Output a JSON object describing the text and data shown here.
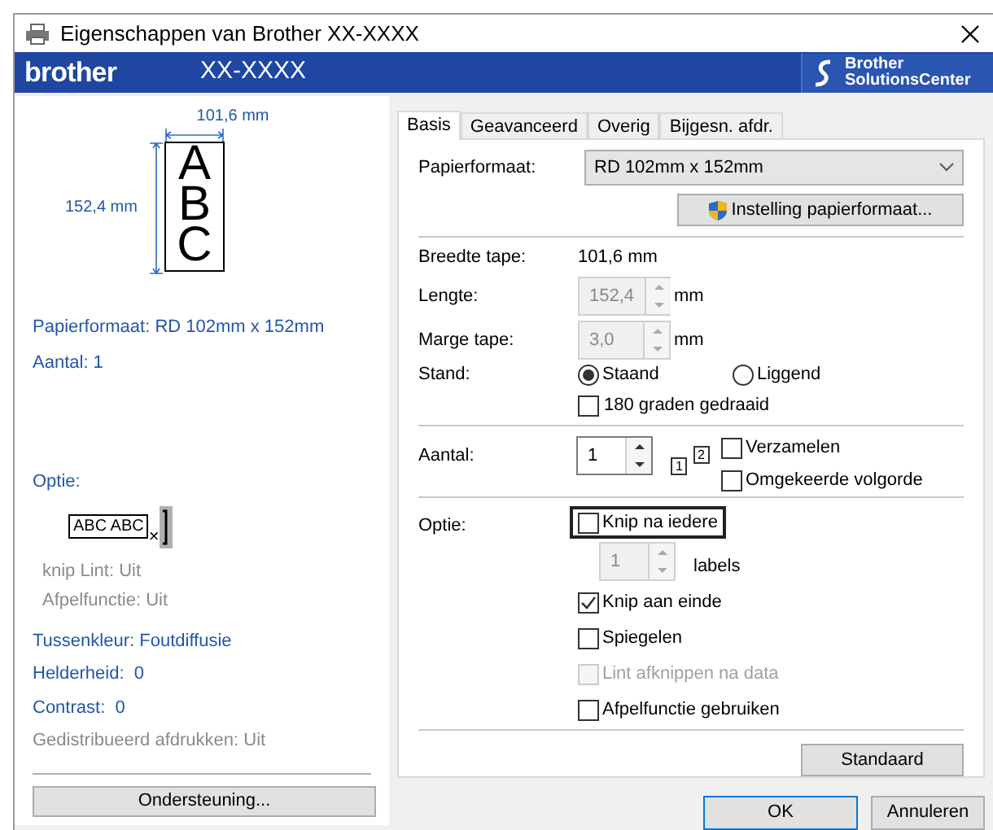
{
  "window": {
    "title": "Eigenschappen van Brother XX-XXXX"
  },
  "header": {
    "logo": "brother",
    "model": "XX-XXXX",
    "solutions_center": [
      "Brother",
      "SolutionsCenter"
    ]
  },
  "preview": {
    "width": "101,6 mm",
    "height": "152,4 mm",
    "letters": [
      "A",
      "B",
      "C"
    ]
  },
  "summary_top": [
    "Papierformaat: RD 102mm x 152mm",
    "Aantal: 1"
  ],
  "option_summary": {
    "label": "Optie:",
    "sample": "ABC ABC",
    "cut_mark": "×",
    "details": [
      "knip Lint: Uit",
      "Afpelfunctie: Uit"
    ]
  },
  "settings_summary": [
    {
      "text": "Tussenkleur: Foutdiffusie",
      "muted": false
    },
    {
      "text": "Helderheid:  0",
      "muted": false
    },
    {
      "text": "Contrast:  0",
      "muted": false
    },
    {
      "text": "Gedistribueerd afdrukken: Uit",
      "muted": true
    }
  ],
  "support_button": "Ondersteuning...",
  "tabs": [
    {
      "label": "Basis",
      "selected": true
    },
    {
      "label": "Geavanceerd",
      "selected": false
    },
    {
      "label": "Overig",
      "selected": false
    },
    {
      "label": "Bijgesn. afdr.",
      "selected": false
    }
  ],
  "basis": {
    "paper_size": {
      "label": "Papierformaat:",
      "value": "RD 102mm x 152mm"
    },
    "paper_setup_button": "Instelling papierformaat...",
    "tape_width": {
      "label": "Breedte tape:",
      "value": "101,6 mm"
    },
    "length": {
      "label": "Lengte:",
      "value": "152,4",
      "unit": "mm",
      "disabled": true
    },
    "margin": {
      "label": "Marge tape:",
      "value": "3,0",
      "unit": "mm",
      "disabled": true
    },
    "orientation": {
      "label": "Stand:",
      "options": [
        {
          "label": "Staand",
          "selected": true
        },
        {
          "label": "Liggend",
          "selected": false
        }
      ]
    },
    "rotate": {
      "label": "180 graden gedraaid",
      "checked": false
    },
    "copies": {
      "label": "Aantal:",
      "value": "1",
      "collate_icon": [
        "1",
        "2"
      ],
      "options": [
        {
          "label": "Verzamelen",
          "checked": false
        },
        {
          "label": "Omgekeerde volgorde",
          "checked": false
        }
      ]
    },
    "option": {
      "label": "Optie:",
      "items": [
        {
          "kind": "checkbox",
          "label": "Knip na iedere",
          "checked": false,
          "disabled": false,
          "focused": true
        },
        {
          "kind": "spin",
          "value": "1",
          "unit": "labels",
          "disabled": true
        },
        {
          "kind": "checkbox",
          "label": "Knip aan einde",
          "checked": true,
          "disabled": false,
          "focused": false
        },
        {
          "kind": "checkbox",
          "label": "Spiegelen",
          "checked": false,
          "disabled": false,
          "focused": false
        },
        {
          "kind": "checkbox",
          "label": "Lint afknippen na data",
          "checked": false,
          "disabled": true,
          "focused": false
        },
        {
          "kind": "checkbox",
          "label": "Afpelfunctie gebruiken",
          "checked": false,
          "disabled": false,
          "focused": false
        }
      ]
    },
    "default_button": "Standaard"
  },
  "buttons": [
    {
      "label": "OK",
      "default": true
    },
    {
      "label": "Annuleren",
      "default": false
    }
  ]
}
